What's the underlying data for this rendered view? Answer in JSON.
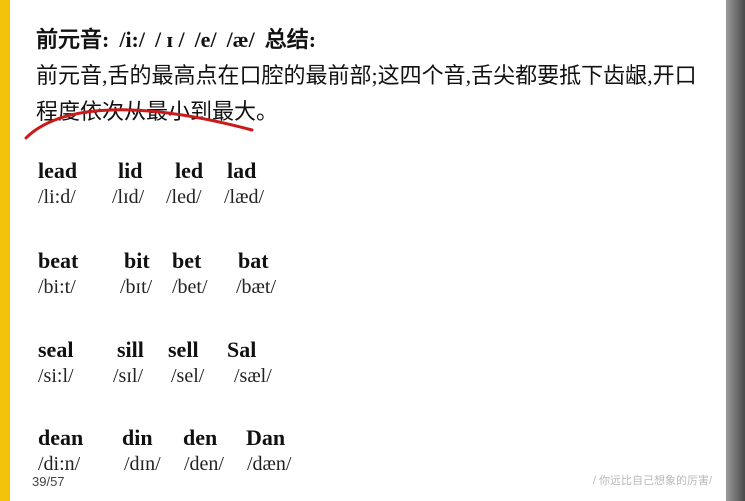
{
  "slide": {
    "title_parts": [
      "前元音:",
      "/i:/",
      "/ ɪ /",
      "/e/",
      "/æ/",
      "总结:"
    ],
    "description": "前元音,舌的最高点在口腔的最前部;这四个音,舌尖都要抵下齿龈,开口程度依次从最小到最大。",
    "groups": [
      {
        "words": [
          "lead",
          "lid",
          "led",
          "lad"
        ],
        "ipa": [
          "/li:d/",
          "/lɪd/",
          "/led/",
          "/læd/"
        ]
      },
      {
        "words": [
          "beat",
          "bit",
          "bet",
          "bat"
        ],
        "ipa": [
          "/bi:t/",
          "/bɪt/",
          "/bet/",
          "/bæt/"
        ]
      },
      {
        "words": [
          "seal",
          "sill",
          "sell",
          "Sal"
        ],
        "ipa": [
          "/si:l/",
          "/sɪl/",
          "/sel/",
          "/sæl/"
        ]
      },
      {
        "words": [
          "dean",
          "din",
          "den",
          "Dan"
        ],
        "ipa": [
          "/di:n/",
          "/dɪn/",
          "/den/",
          "/dæn/"
        ]
      }
    ],
    "page_counter": "39/57",
    "watermark": "/ 你远比自己想象的厉害/"
  },
  "colors": {
    "frame": "#f5c20a",
    "pen_stroke": "#cc1a1a"
  },
  "icons": {
    "annotation": "red-pen-stroke"
  }
}
